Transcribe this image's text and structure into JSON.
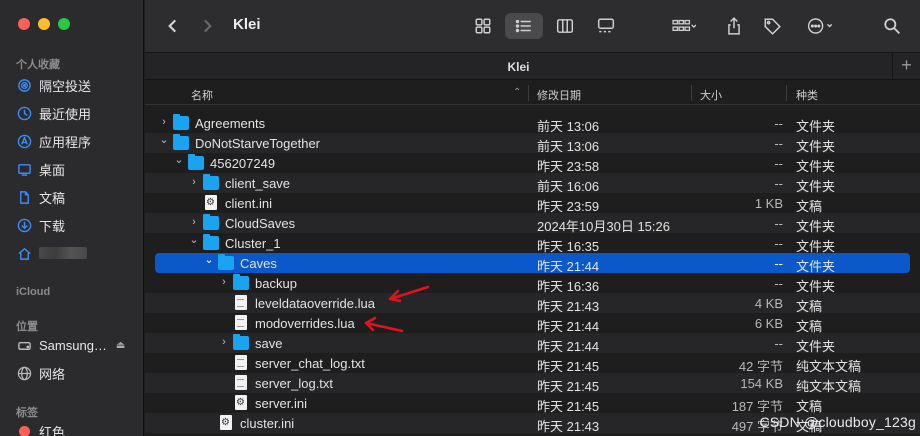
{
  "window": {
    "title": "Klei",
    "tab_title": "Klei"
  },
  "sidebar": {
    "favorites_header": "个人收藏",
    "favorites": [
      {
        "label": "隔空投送",
        "icon": "airdrop-icon"
      },
      {
        "label": "最近使用",
        "icon": "clock-icon"
      },
      {
        "label": "应用程序",
        "icon": "applications-icon"
      },
      {
        "label": "桌面",
        "icon": "desktop-icon"
      },
      {
        "label": "文稿",
        "icon": "document-icon"
      },
      {
        "label": "下载",
        "icon": "download-icon"
      },
      {
        "label": "",
        "icon": "home-icon"
      }
    ],
    "icloud_header": "iCloud",
    "locations_header": "位置",
    "locations": [
      {
        "label": "Samsung…",
        "icon": "drive-icon"
      },
      {
        "label": "网络",
        "icon": "network-icon"
      }
    ],
    "tags_header": "标签",
    "tags": [
      {
        "label": "红色",
        "color": "#fe5f57"
      }
    ]
  },
  "columns": {
    "name": "名称",
    "date": "修改日期",
    "size": "大小",
    "kind": "种类"
  },
  "rows": [
    {
      "name": "Agreements",
      "date": "前天 13:06",
      "size": "--",
      "kind": "文件夹",
      "type": "folder",
      "depth": 0,
      "chevron": "›"
    },
    {
      "name": "DoNotStarveTogether",
      "date": "前天 13:06",
      "size": "--",
      "kind": "文件夹",
      "type": "folder",
      "depth": 0,
      "chevron": "⌄"
    },
    {
      "name": "456207249",
      "date": "昨天 23:58",
      "size": "--",
      "kind": "文件夹",
      "type": "folder",
      "depth": 1,
      "chevron": "⌄"
    },
    {
      "name": "client_save",
      "date": "前天 16:06",
      "size": "--",
      "kind": "文件夹",
      "type": "folder",
      "depth": 2,
      "chevron": "›"
    },
    {
      "name": "client.ini",
      "date": "昨天 23:59",
      "size": "1 KB",
      "kind": "文稿",
      "type": "gear",
      "depth": 2,
      "chevron": ""
    },
    {
      "name": "CloudSaves",
      "date": "2024年10月30日 15:26",
      "size": "--",
      "kind": "文件夹",
      "type": "folder",
      "depth": 2,
      "chevron": "›"
    },
    {
      "name": "Cluster_1",
      "date": "昨天 16:35",
      "size": "--",
      "kind": "文件夹",
      "type": "folder",
      "depth": 2,
      "chevron": "⌄"
    },
    {
      "name": "Caves",
      "date": "昨天 21:44",
      "size": "--",
      "kind": "文件夹",
      "type": "folder",
      "depth": 3,
      "chevron": "⌄",
      "selected": true
    },
    {
      "name": "backup",
      "date": "昨天 16:36",
      "size": "--",
      "kind": "文件夹",
      "type": "folder",
      "depth": 4,
      "chevron": "›"
    },
    {
      "name": "leveldataoverride.lua",
      "date": "昨天 21:43",
      "size": "4 KB",
      "kind": "文稿",
      "type": "doc",
      "depth": 4,
      "chevron": ""
    },
    {
      "name": "modoverrides.lua",
      "date": "昨天 21:44",
      "size": "6 KB",
      "kind": "文稿",
      "type": "doc",
      "depth": 4,
      "chevron": ""
    },
    {
      "name": "save",
      "date": "昨天 21:44",
      "size": "--",
      "kind": "文件夹",
      "type": "folder",
      "depth": 4,
      "chevron": "›"
    },
    {
      "name": "server_chat_log.txt",
      "date": "昨天 21:45",
      "size": "42 字节",
      "kind": "纯文本文稿",
      "type": "doc",
      "depth": 4,
      "chevron": ""
    },
    {
      "name": "server_log.txt",
      "date": "昨天 21:45",
      "size": "154 KB",
      "kind": "纯文本文稿",
      "type": "doc",
      "depth": 4,
      "chevron": ""
    },
    {
      "name": "server.ini",
      "date": "昨天 21:45",
      "size": "187 字节",
      "kind": "文稿",
      "type": "gear",
      "depth": 4,
      "chevron": ""
    },
    {
      "name": "cluster.ini",
      "date": "昨天 21:43",
      "size": "497 字节",
      "kind": "文稿",
      "type": "gear",
      "depth": 3,
      "chevron": ""
    }
  ],
  "watermark": "CSDN @cloudboy_123g",
  "colors": {
    "selection": "#0a58c9",
    "folder": "#1aa3f0",
    "annotation_arrow": "#e0141e"
  }
}
